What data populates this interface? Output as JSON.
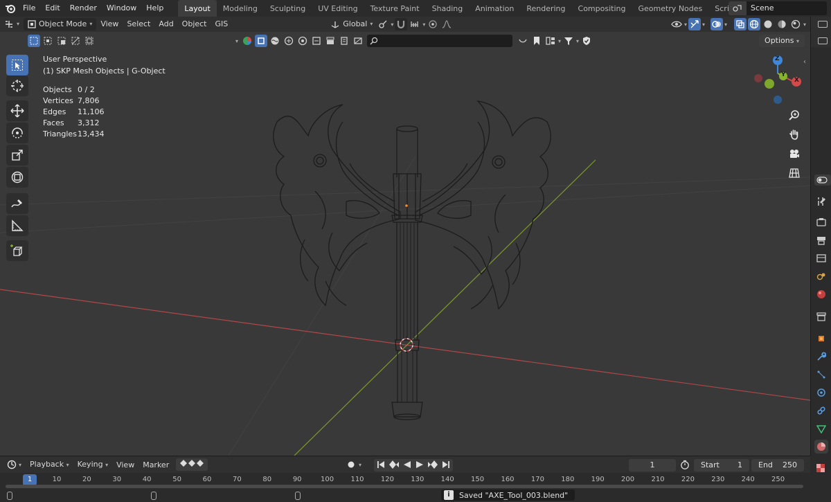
{
  "menus": [
    "File",
    "Edit",
    "Render",
    "Window",
    "Help"
  ],
  "workspaces": [
    "Layout",
    "Modeling",
    "Sculpting",
    "UV Editing",
    "Texture Paint",
    "Shading",
    "Animation",
    "Rendering",
    "Compositing",
    "Geometry Nodes",
    "Scripting"
  ],
  "add_workspace": "+",
  "scene": "Scene",
  "header": {
    "mode": "Object Mode",
    "menus": [
      "View",
      "Select",
      "Add",
      "Object",
      "GIS"
    ],
    "transform_orientation": "Global"
  },
  "options_label": "Options",
  "search_placeholder": "",
  "overlay": {
    "view_name": "User Perspective",
    "collection": "(1) SKP Mesh Objects | G-Object"
  },
  "stats": [
    {
      "key": "Objects",
      "value": "0 / 2"
    },
    {
      "key": "Vertices",
      "value": "7,806"
    },
    {
      "key": "Edges",
      "value": "11,106"
    },
    {
      "key": "Faces",
      "value": "3,312"
    },
    {
      "key": "Triangles",
      "value": "13,434"
    }
  ],
  "gizmo": {
    "z": "Z",
    "y": "Y",
    "x": "X"
  },
  "timeline": {
    "menus": [
      "Playback",
      "Keying",
      "View",
      "Marker"
    ],
    "current_frame": "1",
    "start_label": "Start",
    "start": "1",
    "end_label": "End",
    "end": "250"
  },
  "ruler_current": "1",
  "ruler": [
    "10",
    "20",
    "30",
    "40",
    "50",
    "60",
    "70",
    "80",
    "90",
    "100",
    "110",
    "120",
    "130",
    "140",
    "150",
    "160",
    "170",
    "180",
    "190",
    "200",
    "210",
    "220",
    "230",
    "240",
    "250"
  ],
  "status_message": "Saved \"AXE_Tool_003.blend\"",
  "colors": {
    "accent": "#4772b3",
    "x_axis": "#d24a4a",
    "y_axis": "#86b52b",
    "z_axis": "#3e88dc",
    "viewport_bg": "#393939"
  }
}
